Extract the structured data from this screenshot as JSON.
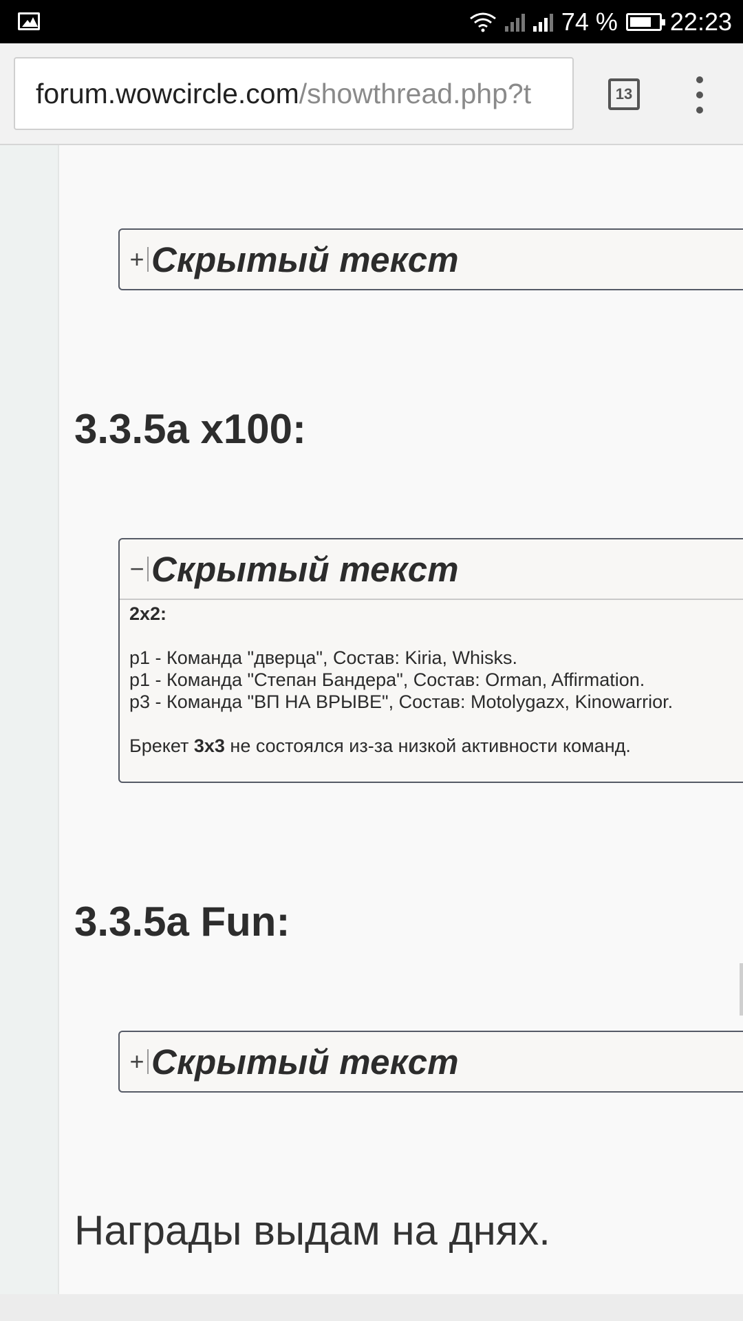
{
  "status_bar": {
    "battery_percent": "74 %",
    "time": "22:23",
    "battery_level": 0.74
  },
  "browser": {
    "url_host": "forum.wowcircle.com",
    "url_path": "/showthread.php?t",
    "tab_count": "13"
  },
  "post": {
    "spoiler_1": {
      "toggle": "+",
      "title": "Скрытый текст"
    },
    "heading_1": "3.3.5a x100:",
    "spoiler_2": {
      "toggle": "−",
      "title": "Скрытый текст",
      "subheading": "2x2:",
      "lines": [
        "p1 - Команда \"дверца\", Состав: Kiria, Whisks.",
        "p1 - Команда \"Степан Бандера\", Состав: Orman, Affirmation.",
        "p3 - Команда \"ВП НА ВРЫВЕ\", Состав: Motolygazx, Kinowarrior."
      ],
      "note_before": "Брекет ",
      "note_bold": "3x3",
      "note_after": " не состоялся из-за низкой активности команд."
    },
    "heading_2": "3.3.5a Fun:",
    "spoiler_3": {
      "toggle": "+",
      "title": "Скрытый текст"
    },
    "footer": "Награды выдам на днях."
  }
}
